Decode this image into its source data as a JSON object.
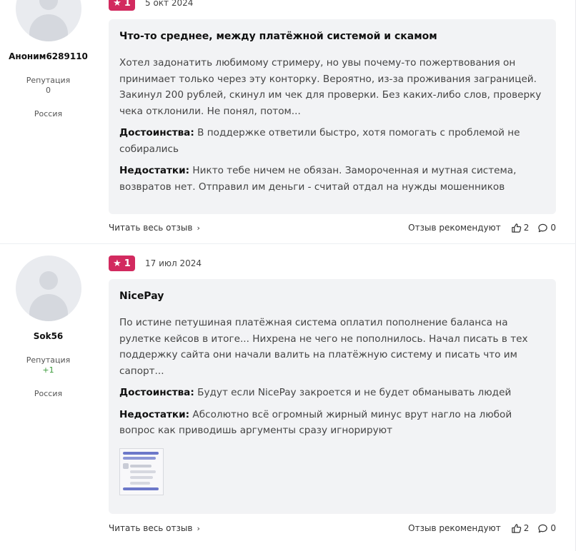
{
  "reviews": [
    {
      "author": {
        "name": "Аноним6289110",
        "reputation_label": "Репутация",
        "reputation_value": "0",
        "country": "Россия"
      },
      "rating": "1",
      "date": "5 окт 2024",
      "title": "Что-то среднее, между платёжной системой и скамом",
      "text": "Хотел задонатить любимому стримеру, но увы почему-то пожертвования он принимает только через эту конторку. Вероятно, из-за проживания заграницей. Закинул 200 рублей, скинул им чек для проверки. Без каких-либо слов, проверку чека отклонили. Не понял, потом...",
      "pros_label": "Достоинства:",
      "pros": "В поддержке ответили быстро, хотя помогать с проблемой не собирались",
      "cons_label": "Недостатки:",
      "cons": "Никто тебе ничем не обязан. Замороченная и мутная система, возвратов нет. Отправил им деньги - считай отдал на нужды мошенников",
      "read_more": "Читать весь отзыв",
      "recommend_label": "Отзыв рекомендуют",
      "likes": "2",
      "comments": "0"
    },
    {
      "author": {
        "name": "Sok56",
        "reputation_label": "Репутация",
        "reputation_value": "+1",
        "country": "Россия"
      },
      "rating": "1",
      "date": "17 июл 2024",
      "title": "NicePay",
      "text": "По истине петушиная платёжная система оплатил пополнение баланса на рулетке кейсов в итоге... Нихрена не чего не пополнилось. Начал писать в тех поддержку сайта они начали валить на платёжную систему и писать что им сапорт...",
      "pros_label": "Достоинства:",
      "pros": "Будут если NicePay закроется и не будет обманывать людей",
      "cons_label": "Недостатки:",
      "cons": "Абсолютно всё огромный жирный минус врут нагло на любой вопрос как приводишь аргументы сразу игнорируют",
      "read_more": "Читать весь отзыв",
      "recommend_label": "Отзыв рекомендуют",
      "likes": "2",
      "comments": "0"
    }
  ],
  "colors": {
    "badge": "#d22a5f",
    "card_bg": "#f2f3f5",
    "positive": "#3a9b3a"
  },
  "icons": {
    "star": "star-icon",
    "thumb": "thumbs-up-icon",
    "comment": "comment-icon",
    "chevron": "chevron-right-icon"
  }
}
